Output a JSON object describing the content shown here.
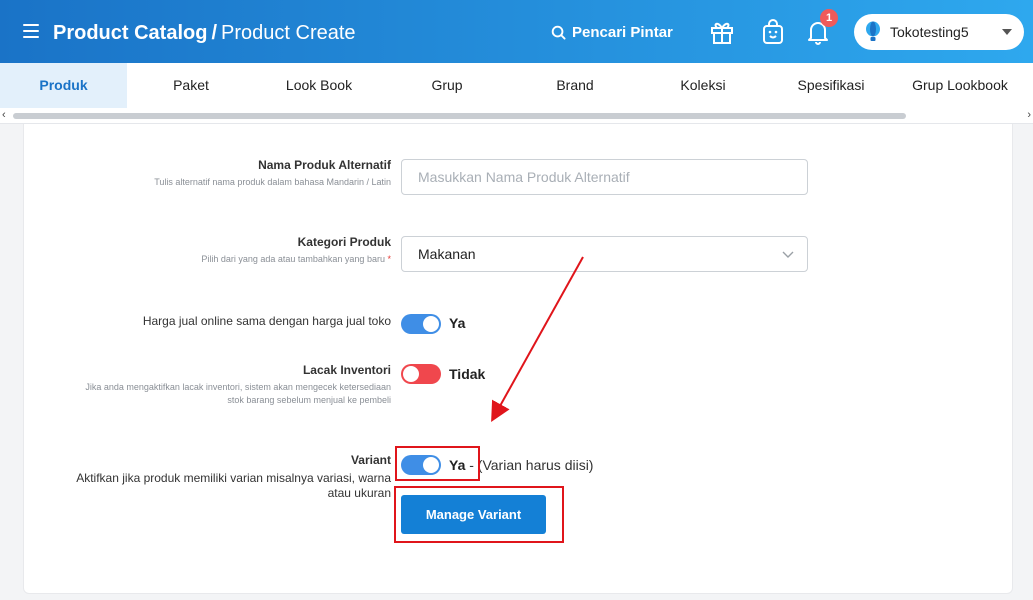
{
  "header": {
    "title_main": "Product Catalog",
    "title_sep": "/",
    "title_sub": "Product Create",
    "smart_search": "Pencari Pintar",
    "notification_count": "1",
    "store_name": "Tokotesting5"
  },
  "tabs": [
    {
      "label": "Produk",
      "active": true
    },
    {
      "label": "Paket"
    },
    {
      "label": "Look Book"
    },
    {
      "label": "Grup"
    },
    {
      "label": "Brand"
    },
    {
      "label": "Koleksi"
    },
    {
      "label": "Spesifikasi"
    },
    {
      "label": "Grup Lookbook"
    }
  ],
  "form": {
    "alt_name": {
      "label": "Nama Produk Alternatif",
      "hint": "Tulis alternatif nama produk dalam bahasa Mandarin / Latin",
      "placeholder": "Masukkan Nama Produk Alternatif"
    },
    "category": {
      "label": "Kategori Produk",
      "hint": "Pilih dari yang ada atau tambahkan yang baru",
      "required_mark": "*",
      "value": "Makanan"
    },
    "online_price": {
      "label": "Harga jual online sama dengan harga jual toko",
      "state": "Ya"
    },
    "inventory": {
      "label": "Lacak Inventori",
      "hint_line1": "Jika anda mengaktifkan lacak inventori, sistem akan mengecek ketersediaan",
      "hint_line2": "stok barang sebelum menjual ke pembeli",
      "state": "Tidak"
    },
    "variant": {
      "label": "Variant",
      "hint_line1": "Aktifkan jika produk memiliki varian misalnya variasi, warna",
      "hint_line2": "atau ukuran",
      "state": "Ya",
      "note": " - (Varian harus diisi)"
    },
    "manage_variant_label": "Manage Variant"
  },
  "colors": {
    "header_start": "#1a73c7",
    "header_end": "#2ea8ee",
    "toggle_on": "#3f8ee6",
    "toggle_off": "#f0474d",
    "primary_button": "#1480d6",
    "annotation": "#e0151b"
  },
  "icons": {
    "menu": "hamburger-icon",
    "search": "search-icon",
    "gift": "gift-icon",
    "shop": "shopping-bag-icon",
    "bell": "bell-icon",
    "store": "balloon-icon"
  }
}
